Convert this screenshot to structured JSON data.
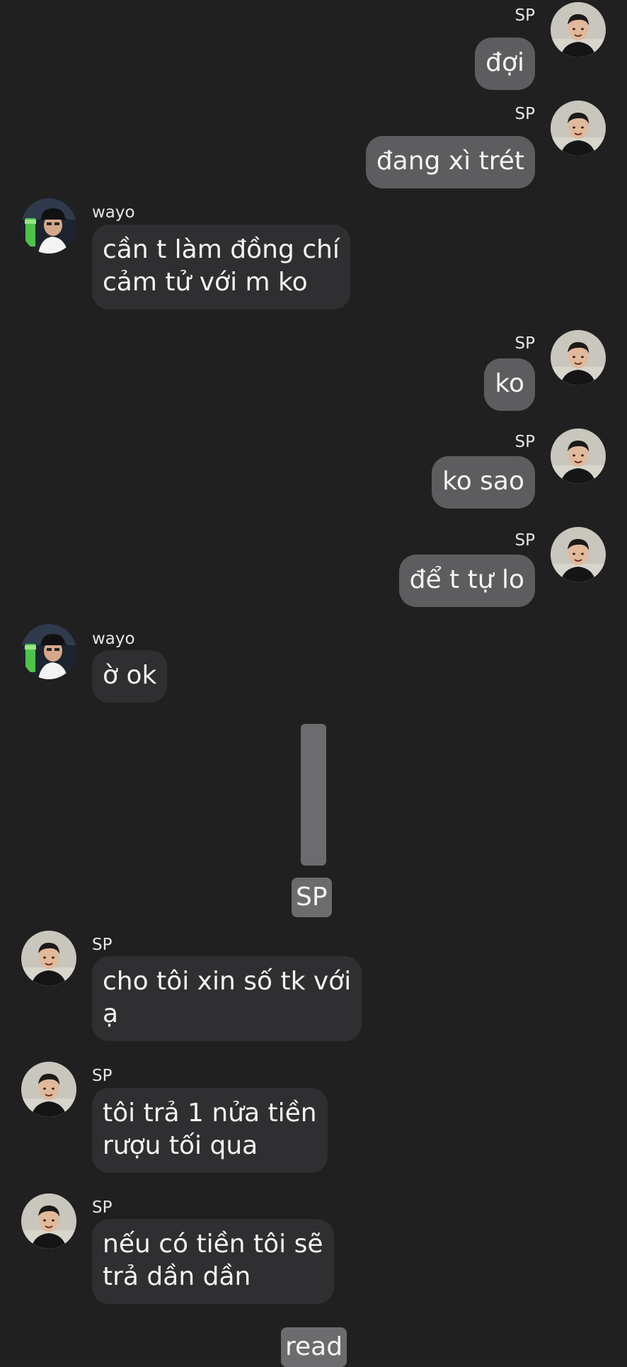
{
  "messages": [
    {
      "sender": "SP",
      "text": "đợi"
    },
    {
      "sender": "SP",
      "text": "đang xì trét"
    },
    {
      "sender": "wayo",
      "text": "cần t làm đồng chí\ncảm tử với m ko"
    },
    {
      "sender": "SP",
      "text": "ko"
    },
    {
      "sender": "SP",
      "text": "ko sao"
    },
    {
      "sender": "SP",
      "text": "để t tự lo"
    },
    {
      "sender": "wayo",
      "text": "ờ ok"
    },
    {
      "sender": "SP",
      "text": "cho tôi xin số tk với\nạ"
    },
    {
      "sender": "SP",
      "text": "tôi trả 1 nửa tiền\nrượu tối qua"
    },
    {
      "sender": "SP",
      "text": "nếu có tiền tôi sẽ\ntrả dần dần"
    }
  ],
  "media_tag": "SP",
  "read_label": "read",
  "colors": {
    "background": "#202021",
    "outgoing_bubble": "#5d5d5f",
    "incoming_bubble": "#2f2f31"
  }
}
